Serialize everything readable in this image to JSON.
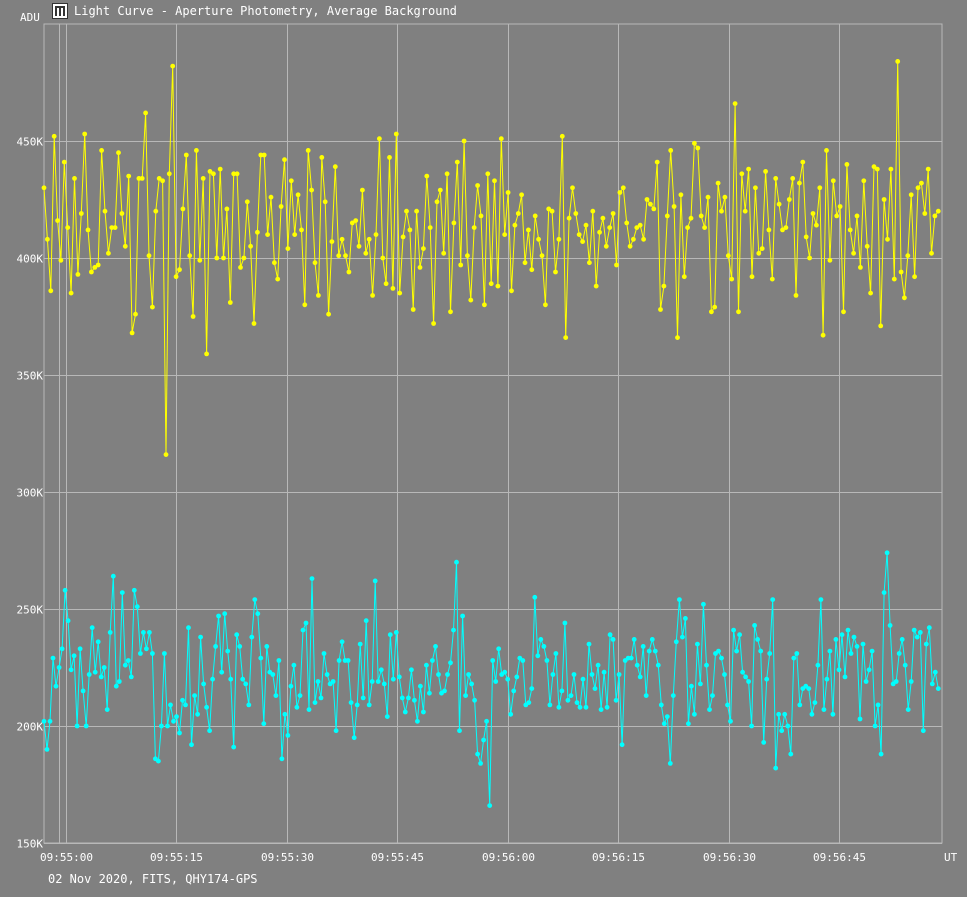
{
  "window": {
    "title": "Light Curve - Aperture Photometry, Average Background",
    "icon": "light-curve-app-icon"
  },
  "footer": {
    "caption": "02 Nov 2020, FITS, QHY174-GPS"
  },
  "colors": {
    "background": "#808080",
    "grid": "#b8b8b8",
    "axis_text": "#ffffff",
    "series_target": "#ffff00",
    "series_comparison": "#00ffff"
  },
  "chart_data": {
    "type": "line",
    "title": "",
    "xlabel": "UT",
    "ylabel": "ADU",
    "xlim": [
      "09:54:57",
      "09:56:59"
    ],
    "ylim": [
      150000,
      500000
    ],
    "grid": true,
    "legend": "none",
    "x_ticks": [
      "09:55:00",
      "09:55:15",
      "09:55:30",
      "09:55:45",
      "09:56:00",
      "09:56:15",
      "09:56:30",
      "09:56:45"
    ],
    "y_ticks": [
      {
        "value": 150000,
        "label": "150K"
      },
      {
        "value": 200000,
        "label": "200K"
      },
      {
        "value": 250000,
        "label": "250K"
      },
      {
        "value": 300000,
        "label": "300K"
      },
      {
        "value": 350000,
        "label": "350K"
      },
      {
        "value": 400000,
        "label": "400K"
      },
      {
        "value": 450000,
        "label": "450K"
      }
    ],
    "series_start_time": "09:54:57",
    "series_end_time": "09:56:58.5",
    "series": [
      {
        "color": "#ffff00",
        "values": [
          430,
          408,
          386,
          452,
          416,
          399,
          441,
          413,
          385,
          434,
          393,
          419,
          453,
          412,
          394,
          396,
          397,
          446,
          420,
          402,
          413,
          413,
          445,
          419,
          405,
          435,
          368,
          376,
          434,
          434,
          462,
          401,
          379,
          420,
          434,
          433,
          316,
          436,
          482,
          392,
          395,
          421,
          444,
          401,
          375,
          446,
          399,
          434,
          359,
          437,
          436,
          400,
          438,
          400,
          421,
          381,
          436,
          436,
          396,
          400,
          424,
          405,
          372,
          411,
          444,
          444,
          410,
          426,
          398,
          391,
          422,
          442,
          404,
          433,
          410,
          427,
          412,
          380,
          446,
          429,
          398,
          384,
          443,
          424,
          376,
          407,
          439,
          401,
          408,
          401,
          394,
          415,
          416,
          405,
          429,
          402,
          408,
          384,
          410,
          451,
          400,
          389,
          443,
          387,
          453,
          385,
          409,
          420,
          412,
          378,
          420,
          396,
          404,
          435,
          413,
          372,
          424,
          429,
          402,
          436,
          377,
          415,
          441,
          397,
          450,
          401,
          382,
          413,
          431,
          418,
          380,
          436,
          389,
          433,
          388,
          451,
          410,
          428,
          386,
          414,
          419,
          427,
          398,
          412,
          395,
          418,
          408,
          401,
          380,
          421,
          420,
          394,
          408,
          452,
          366,
          417,
          430,
          419,
          410,
          407,
          414,
          398,
          420,
          388,
          411,
          417,
          405,
          413,
          419,
          397,
          428,
          430,
          415,
          405,
          408,
          413,
          414,
          408,
          425,
          423,
          421,
          441,
          378,
          388,
          418,
          446,
          422,
          366,
          427,
          392,
          413,
          417,
          449,
          447,
          418,
          413,
          426,
          377,
          379,
          432,
          420,
          426,
          401,
          391,
          466,
          377,
          436,
          420,
          438,
          392,
          430,
          402,
          404,
          437,
          412,
          391,
          434,
          423,
          412,
          413,
          425,
          434,
          384,
          432,
          441,
          409,
          400,
          419,
          414,
          430,
          367,
          446,
          399,
          433,
          418,
          422,
          377,
          440,
          412,
          402,
          418,
          396,
          433,
          405,
          385,
          439,
          438,
          371,
          425,
          408,
          438,
          391,
          484,
          394,
          383,
          401,
          427,
          392,
          430,
          432,
          419,
          438,
          402,
          418,
          420
        ],
        "value_scale": 1000
      },
      {
        "color": "#00ffff",
        "values": [
          202,
          190,
          202,
          229,
          217,
          225,
          233,
          258,
          245,
          224,
          230,
          200,
          233,
          215,
          200,
          222,
          242,
          223,
          236,
          221,
          225,
          207,
          240,
          264,
          217,
          219,
          257,
          226,
          228,
          221,
          258,
          251,
          231,
          240,
          233,
          240,
          231,
          186,
          185,
          200,
          231,
          200,
          209,
          202,
          204,
          197,
          211,
          209,
          242,
          192,
          213,
          205,
          238,
          218,
          208,
          198,
          220,
          234,
          247,
          223,
          248,
          232,
          220,
          191,
          239,
          234,
          220,
          218,
          209,
          238,
          254,
          248,
          229,
          201,
          234,
          223,
          222,
          213,
          228,
          186,
          205,
          196,
          217,
          226,
          208,
          213,
          241,
          244,
          207,
          263,
          210,
          219,
          212,
          231,
          222,
          218,
          219,
          198,
          228,
          236,
          228,
          228,
          210,
          195,
          209,
          235,
          212,
          245,
          209,
          219,
          262,
          219,
          224,
          218,
          204,
          239,
          220,
          240,
          221,
          212,
          206,
          212,
          224,
          211,
          202,
          217,
          206,
          226,
          214,
          228,
          234,
          222,
          214,
          215,
          222,
          227,
          241,
          270,
          198,
          247,
          213,
          222,
          218,
          211,
          188,
          184,
          194,
          202,
          166,
          228,
          219,
          233,
          222,
          223,
          220,
          205,
          215,
          221,
          229,
          228,
          209,
          210,
          216,
          255,
          230,
          237,
          234,
          228,
          209,
          222,
          231,
          208,
          215,
          244,
          211,
          213,
          222,
          210,
          208,
          220,
          208,
          235,
          222,
          216,
          226,
          207,
          223,
          208,
          239,
          237,
          211,
          222,
          192,
          228,
          229,
          229,
          237,
          226,
          221,
          234,
          213,
          232,
          237,
          232,
          226,
          209,
          201,
          204,
          184,
          213,
          236,
          254,
          238,
          246,
          201,
          217,
          205,
          235,
          218,
          252,
          226,
          207,
          213,
          231,
          232,
          229,
          222,
          209,
          202,
          241,
          232,
          239,
          223,
          221,
          219,
          200,
          243,
          237,
          232,
          193,
          220,
          231,
          254,
          182,
          205,
          198,
          205,
          200,
          188,
          229,
          231,
          209,
          216,
          217,
          216,
          205,
          210,
          226,
          254,
          207,
          220,
          232,
          205,
          237,
          224,
          239,
          221,
          241,
          231,
          238,
          234,
          203,
          235,
          219,
          224,
          232,
          200,
          209,
          188,
          257,
          274,
          243,
          218,
          219,
          231,
          237,
          226,
          207,
          219,
          241,
          238,
          240,
          198,
          235,
          242,
          218,
          223,
          216
        ]
      }
    ]
  }
}
